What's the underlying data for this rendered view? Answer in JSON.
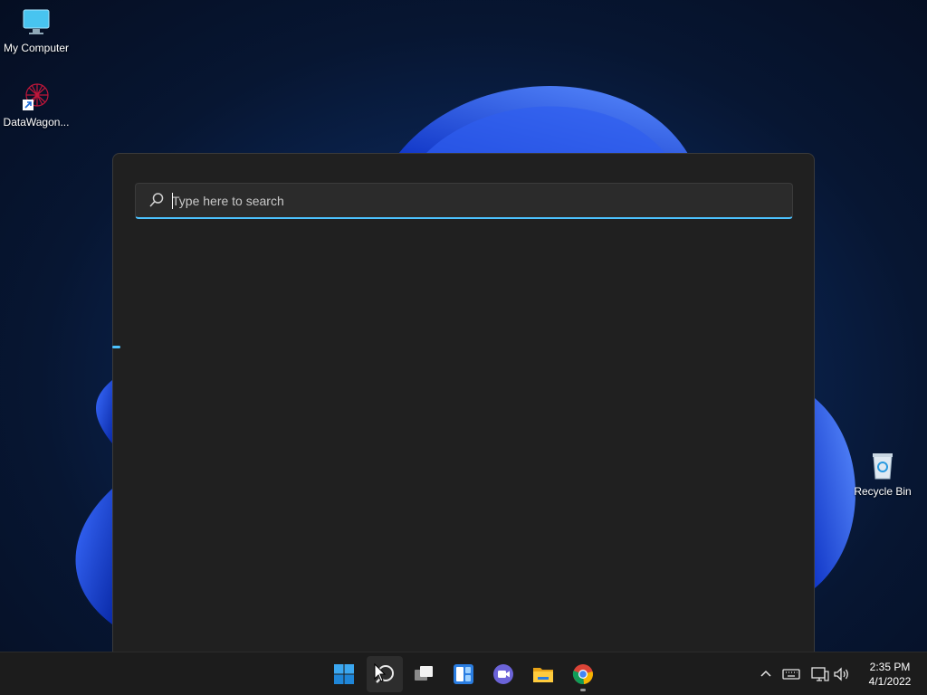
{
  "desktop": {
    "icons": [
      {
        "label": "My Computer",
        "icon": "monitor-icon"
      },
      {
        "label": "DataWagon...",
        "icon": "datawagon-logo-icon"
      },
      {
        "label": "Recycle Bin",
        "icon": "recycle-bin-icon"
      }
    ]
  },
  "search": {
    "placeholder": "Type here to search",
    "value": ""
  },
  "taskbar": {
    "apps": [
      {
        "name": "Start",
        "icon": "windows-start-icon"
      },
      {
        "name": "Search",
        "icon": "search-icon",
        "active": true
      },
      {
        "name": "Task View",
        "icon": "task-view-icon"
      },
      {
        "name": "Widgets",
        "icon": "widgets-icon"
      },
      {
        "name": "Chat",
        "icon": "teams-chat-icon"
      },
      {
        "name": "File Explorer",
        "icon": "folder-icon"
      },
      {
        "name": "Google Chrome",
        "icon": "chrome-icon",
        "running": true
      }
    ],
    "tray": [
      "chevron-up-icon",
      "keyboard-icon",
      "network-icon",
      "volume-icon"
    ],
    "clock": {
      "time": "2:35 PM",
      "date": "4/1/2022"
    }
  },
  "colors": {
    "accent": "#4cc2ff",
    "panel": "#202020",
    "taskbar": "#1c1c1c"
  }
}
